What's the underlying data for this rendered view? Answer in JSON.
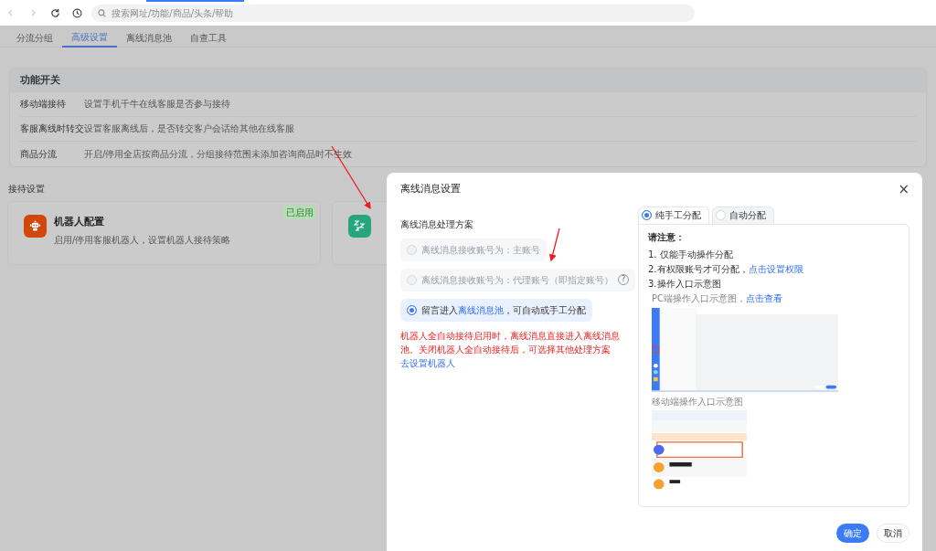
{
  "browser": {
    "address_placeholder": "搜索网址/功能/商品/头条/帮助"
  },
  "tabs": [
    {
      "label": "分流分组",
      "selected": false
    },
    {
      "label": "高级设置",
      "selected": true
    },
    {
      "label": "离线消息池",
      "selected": false
    },
    {
      "label": "自查工具",
      "selected": false
    }
  ],
  "feature_switches": {
    "title": "功能开关",
    "rows": [
      {
        "name": "移动端接待",
        "description": "设置手机千牛在线客服是否参与接待"
      },
      {
        "name": "客服离线时转交",
        "description": "设置客服离线后，是否转交客户会话给其他在线客服"
      },
      {
        "name": "商品分流",
        "description": "开启/停用全店按商品分流，分组接待范围未添加咨询商品时不生效"
      }
    ]
  },
  "reception": {
    "title": "接待设置",
    "cards": [
      {
        "kind": "robot",
        "title": "机器人配置",
        "description": "启用/停用客服机器人，设置机器人接待策略",
        "badge": "已启用"
      },
      {
        "kind": "sleep"
      }
    ]
  },
  "dialog": {
    "title": "离线消息设置",
    "close": "×",
    "section_title": "离线消息处理方案",
    "options": [
      {
        "label": "离线消息接收账号为：主账号",
        "selected": false,
        "disabled": true
      },
      {
        "label": "离线消息接收账号为：代理账号（即指定账号）",
        "selected": false,
        "disabled": true,
        "help": "?"
      },
      {
        "label": "留言进入",
        "link": "离线消息池",
        "label_after": "，可自动或手工分配",
        "selected": true,
        "disabled": false
      }
    ],
    "warning": {
      "text": "机器人全自动接待启用时，离线消息直接进入离线消息池。关闭机器人全自动接待后，可选择其他处理方案",
      "link": "去设置机器人"
    },
    "assign_tabs": [
      {
        "label": "纯手工分配",
        "selected": true
      },
      {
        "label": "自动分配",
        "selected": false
      }
    ],
    "notes": {
      "title": "请注意：",
      "items": [
        {
          "text": "1. 仅能手动操作分配"
        },
        {
          "text": "2.有权限账号才可分配，",
          "link": "点击设置权限"
        },
        {
          "text": "3.操作入口示意图"
        }
      ],
      "pc_caption": "PC端操作入口示意图，",
      "pc_link": "点击查看",
      "mobile_caption": "移动端操作入口示意图"
    },
    "buttons": [
      {
        "label": "确定",
        "kind": "primary"
      },
      {
        "label": "取消",
        "kind": "secondary"
      }
    ]
  }
}
